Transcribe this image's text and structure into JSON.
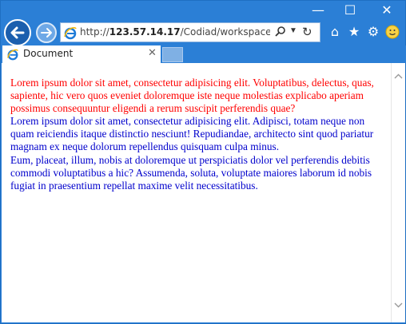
{
  "browser": {
    "address_url_prefix": "http://",
    "address_url_host": "123.57.14.17",
    "address_url_path": "/Codiad/workspace/co",
    "tab_title": "Document",
    "accent_color": "#2b7fd6"
  },
  "content": {
    "paragraph_1": "Lorem ipsum dolor sit amet, consectetur adipisicing elit. Voluptatibus, delectus, quas, sapiente, hic vero quos eveniet doloremque iste neque molestias explicabo aperiam possimus consequuntur eligendi a rerum suscipit perferendis quae?",
    "paragraph_1_color": "#ff0000",
    "paragraph_2": "Lorem ipsum dolor sit amet, consectetur adipisicing elit. Adipisci, totam neque non quam reiciendis itaque distinctio nesciunt! Repudiandae, architecto sint quod pariatur magnam ex neque dolorum repellendus quisquam culpa minus.",
    "paragraph_2_color": "#0000cc",
    "paragraph_3": "Eum, placeat, illum, nobis at doloremque ut perspiciatis dolor vel perferendis debitis commodi voluptatibus a hic? Assumenda, soluta, voluptate maiores laborum id nobis fugiat in praesentium repellat maxime velit necessitatibus.",
    "paragraph_3_color": "#0000cc"
  },
  "icons": [
    "minimize-icon",
    "maximize-icon",
    "close-icon",
    "back-arrow-icon",
    "forward-arrow-icon",
    "ie-icon",
    "search-icon",
    "dropdown-icon",
    "refresh-icon",
    "home-icon",
    "favorites-star-icon",
    "gear-icon",
    "smiley-feedback-icon",
    "scroll-up-icon",
    "scroll-down-icon"
  ]
}
